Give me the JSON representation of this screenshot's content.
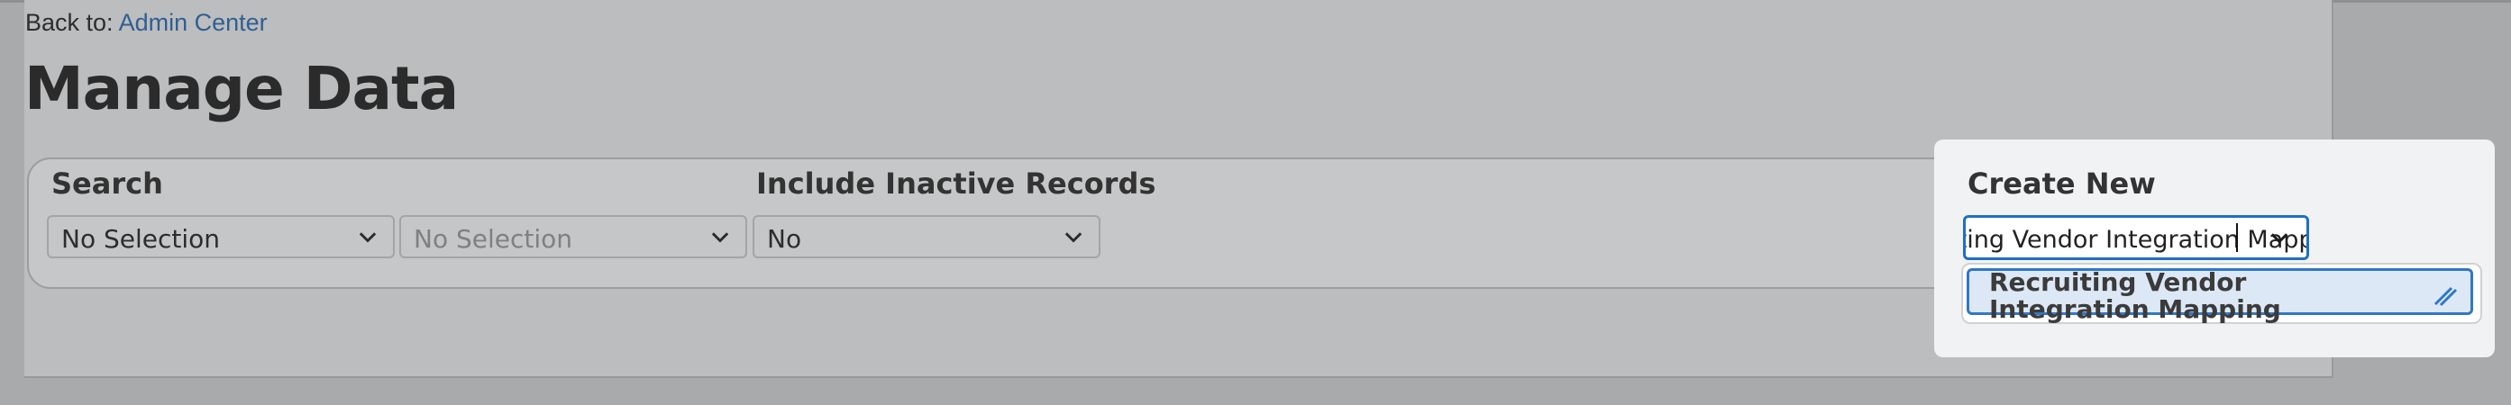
{
  "breadcrumb": {
    "prefix": "Back to:",
    "link_label": "Admin Center"
  },
  "page": {
    "title": "Manage Data"
  },
  "search": {
    "label": "Search",
    "select1_value": "No Selection",
    "select2_value": "No Selection",
    "include_inactive_label": "Include Inactive Records",
    "include_inactive_value": "No"
  },
  "create_new": {
    "label": "Create New",
    "input_value": "Recruiting Vendor Integration Mapping",
    "options": [
      {
        "label": "Recruiting Vendor Integration Mapping"
      }
    ]
  },
  "icons": {
    "select_chevron": "chevron-down-icon",
    "option_edit": "pencil-icon"
  },
  "colors": {
    "link": "#2f5f93",
    "focus": "#1f6fc1",
    "selected_option_bg": "#dde8f6"
  }
}
